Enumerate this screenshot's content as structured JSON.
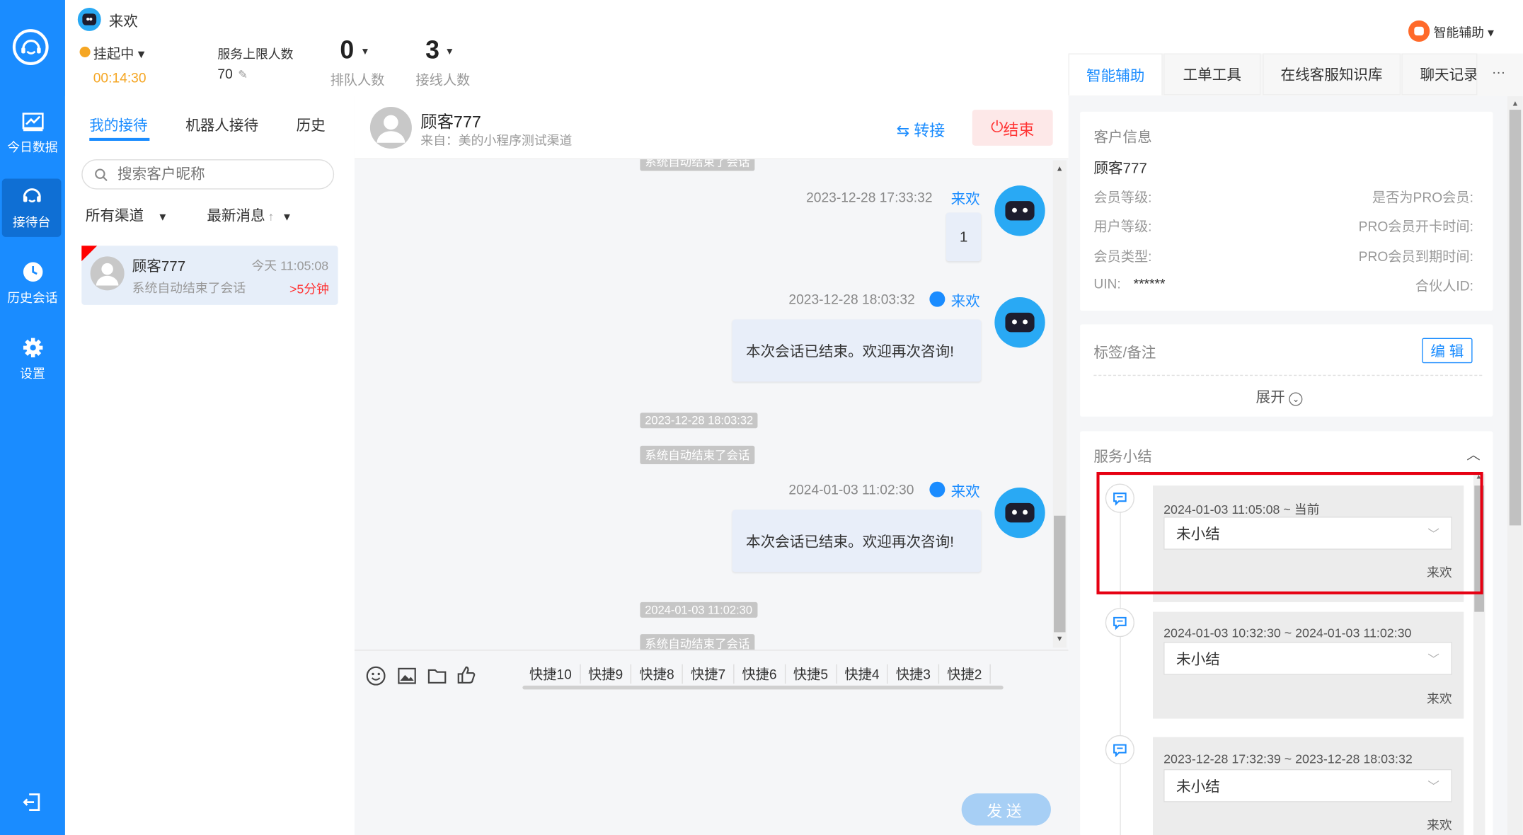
{
  "app": {
    "name": "来欢"
  },
  "nav": {
    "items": [
      {
        "label": "今日数据",
        "icon": "chart-icon"
      },
      {
        "label": "接待台",
        "icon": "headset-icon"
      },
      {
        "label": "历史会话",
        "icon": "clock-icon"
      },
      {
        "label": "设置",
        "icon": "gear-icon"
      }
    ]
  },
  "header": {
    "status": "挂起中",
    "timer": "00:14:30",
    "service_limit_label": "服务上限人数",
    "service_limit_value": "70",
    "queue_count": "0",
    "queue_label": "排队人数",
    "online_count": "3",
    "online_label": "接线人数",
    "assistant_menu": "智能辅助"
  },
  "list": {
    "tabs": [
      "我的接待",
      "机器人接待",
      "历史"
    ],
    "search_placeholder": "搜索客户昵称",
    "filter_channel": "所有渠道",
    "filter_sort": "最新消息",
    "items": [
      {
        "name": "顾客777",
        "time": "今天 11:05:08",
        "preview": "系统自动结束了会话",
        "wait": ">5分钟"
      }
    ]
  },
  "chat": {
    "customer_name": "顾客777",
    "source": "来自：美的小程序测试渠道",
    "transfer_label": "转接",
    "end_label": "结束",
    "messages": [
      {
        "sys_top": "系统自动结束了会话"
      },
      {
        "time": "2023-12-28 17:33:32",
        "name": "来欢",
        "text": "1"
      },
      {
        "time": "2023-12-28 18:03:32",
        "name": "来欢",
        "text": "本次会话已结束。欢迎再次咨询!"
      },
      {
        "sys_time": "2023-12-28 18:03:32",
        "sys": "系统自动结束了会话"
      },
      {
        "time": "2024-01-03 11:02:30",
        "name": "来欢",
        "text": "本次会话已结束。欢迎再次咨询!"
      },
      {
        "sys_time": "2024-01-03 11:02:30",
        "sys": "系统自动结束了会话"
      }
    ],
    "quick_replies": [
      "快捷10",
      "快捷9",
      "快捷8",
      "快捷7",
      "快捷6",
      "快捷5",
      "快捷4",
      "快捷3",
      "快捷2"
    ],
    "send_label": "发送"
  },
  "right": {
    "tabs": [
      "智能辅助",
      "工单工具",
      "在线客服知识库",
      "聊天记录"
    ],
    "more": "···",
    "customer_info": {
      "title": "客户信息",
      "name": "顾客777",
      "member_level": "会员等级:",
      "is_pro": "是否为PRO会员:",
      "user_level": "用户等级:",
      "pro_open_time": "PRO会员开卡时间:",
      "member_type": "会员类型:",
      "pro_expire_time": "PRO会员到期时间:",
      "uin_label": "UIN:",
      "uin_value": "******",
      "partner_id": "合伙人ID:"
    },
    "tags": {
      "title": "标签/备注",
      "edit": "编 辑",
      "expand": "展开"
    },
    "summary": {
      "title": "服务小结",
      "items": [
        {
          "range": "2024-01-03 11:05:08 ~ 当前",
          "value": "未小结",
          "agent": "来欢"
        },
        {
          "range": "2024-01-03 10:32:30 ~ 2024-01-03 11:02:30",
          "value": "未小结",
          "agent": "来欢"
        },
        {
          "range": "2023-12-28 17:32:39 ~ 2023-12-28 18:03:32",
          "value": "未小结",
          "agent": "来欢"
        }
      ]
    }
  }
}
